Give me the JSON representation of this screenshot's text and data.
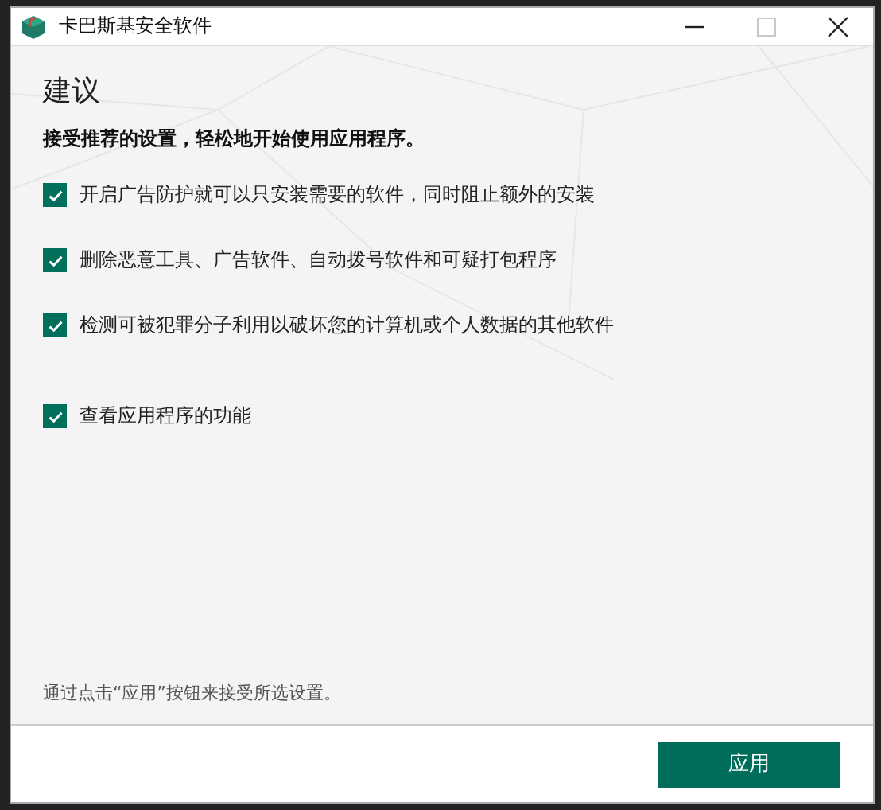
{
  "window": {
    "title": "卡巴斯基安全软件"
  },
  "heading": "建议",
  "subheading": "接受推荐的设置，轻松地开始使用应用程序。",
  "options": [
    {
      "label": "开启广告防护就可以只安装需要的软件，同时阻止额外的安装",
      "checked": true
    },
    {
      "label": "删除恶意工具、广告软件、自动拨号软件和可疑打包程序",
      "checked": true
    },
    {
      "label": "检测可被犯罪分子利用以破坏您的计算机或个人数据的其他软件",
      "checked": true
    },
    {
      "label": "查看应用程序的功能",
      "checked": true,
      "separated": true
    }
  ],
  "hint": "通过点击“应用”按钮来接受所选设置。",
  "buttons": [
    "应用"
  ]
}
